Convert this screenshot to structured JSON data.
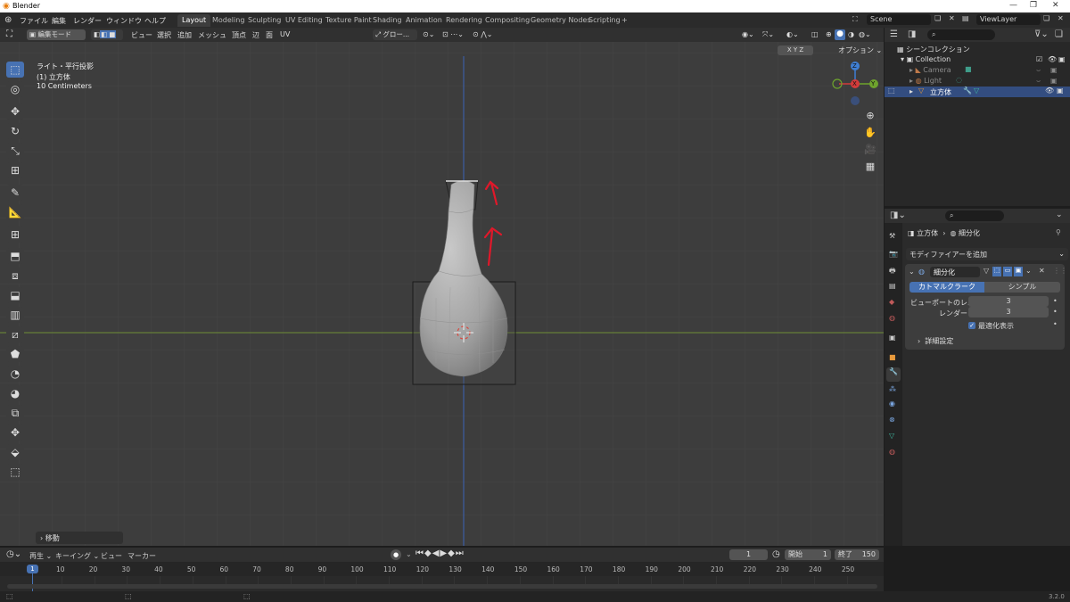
{
  "window": {
    "title": "Blender"
  },
  "menus": [
    "ファイル",
    "編集",
    "レンダー",
    "ウィンドウ",
    "ヘルプ"
  ],
  "workspace_tabs": [
    "Layout",
    "Modeling",
    "Sculpting",
    "UV Editing",
    "Texture Paint",
    "Shading",
    "Animation",
    "Rendering",
    "Compositing",
    "Geometry Nodes",
    "Scripting",
    "+"
  ],
  "scene": {
    "label": "Scene",
    "view_layer": "ViewLayer"
  },
  "viewport_header": {
    "mode": "編集モード",
    "menus": [
      "ビュー",
      "選択",
      "追加",
      "メッシュ",
      "頂点",
      "辺",
      "面",
      "UV"
    ],
    "transform_orientation": "グロー...",
    "options_label": "オプション ⌄",
    "axes": [
      "X",
      "Y",
      "Z"
    ]
  },
  "viewport": {
    "info_line1": "ライト・平行投影",
    "info_line2": "(1) 立方体",
    "info_line3": "10 Centimeters",
    "last_op": "移動",
    "gizmo_axes": [
      "Y",
      "X",
      "Z"
    ]
  },
  "outliner": {
    "root": "シーンコレクション",
    "collection": "Collection",
    "items": [
      {
        "name": "Camera"
      },
      {
        "name": "Light"
      },
      {
        "name": "立方体"
      }
    ]
  },
  "properties": {
    "breadcrumb_object": "立方体",
    "breadcrumb_modifier": "細分化",
    "add_modifier": "モディファイアーを追加",
    "modifier_name": "細分化",
    "tab_catmull": "カトマルクラーク",
    "tab_simple": "シンプル",
    "viewport_levels_label": "ビューポートのレ...",
    "viewport_levels": "3",
    "render_label": "レンダー",
    "render_levels": "3",
    "optimal_display": "最適化表示",
    "advanced": "詳細設定"
  },
  "timeline": {
    "menus": [
      "再生",
      "キーイング",
      "ビュー",
      "マーカー"
    ],
    "current_frame": "1",
    "start_label": "開始",
    "start": "1",
    "end_label": "終了",
    "end": "150",
    "ticks": [
      "1",
      "10",
      "20",
      "30",
      "40",
      "50",
      "60",
      "70",
      "80",
      "90",
      "100",
      "110",
      "120",
      "130",
      "140",
      "150",
      "160",
      "170",
      "180",
      "190",
      "200",
      "210",
      "220",
      "230",
      "240",
      "250"
    ]
  },
  "status": {
    "version": "3.2.0"
  },
  "colors": {
    "accent": "#4772b3",
    "annotation": "#e0182a",
    "x_axis": "#d43b3b",
    "y_axis": "#6ea32d",
    "z_axis": "#3f7fd4"
  }
}
